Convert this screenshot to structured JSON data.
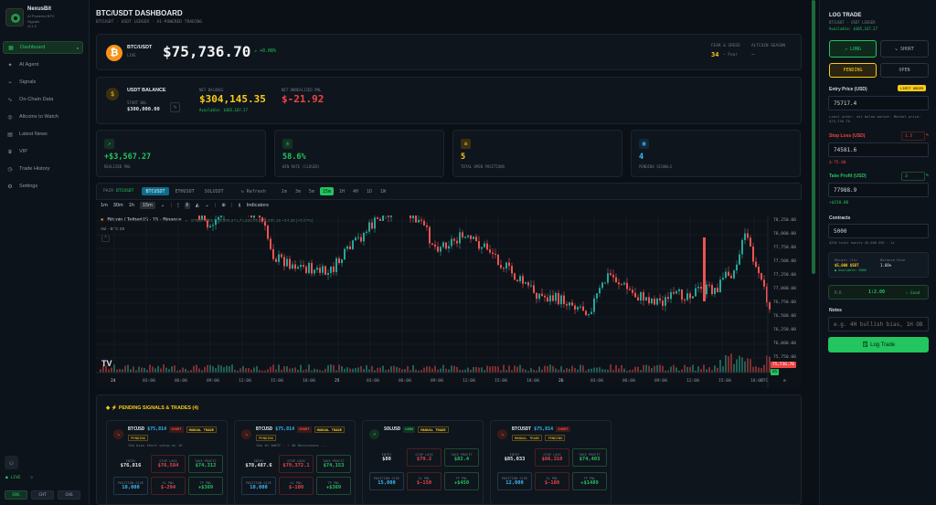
{
  "sidebar": {
    "brand": "NexusBit",
    "brand_sub1": "AI Powered BTC",
    "brand_sub2": "Signals",
    "brand_sub3": "v2.1.0",
    "items": [
      {
        "label": "Dashboard",
        "icon": "grid-icon"
      },
      {
        "label": "AI Agent",
        "icon": "sparkle-icon"
      },
      {
        "label": "Signals",
        "icon": "signal-icon"
      },
      {
        "label": "On-Chain Data",
        "icon": "activity-icon"
      },
      {
        "label": "Altcoins to Watch",
        "icon": "eye-icon"
      },
      {
        "label": "Latest News",
        "icon": "news-icon"
      },
      {
        "label": "VIP",
        "icon": "crown-icon"
      },
      {
        "label": "Trade History",
        "icon": "clock-icon"
      },
      {
        "label": "Settings",
        "icon": "gear-icon"
      }
    ],
    "live": "LIVE",
    "lang": [
      "ENG",
      "CHT",
      "CHS"
    ]
  },
  "header": {
    "title": "BTC/USDT DASHBOARD",
    "subtitle": "BTCUSDT · USDT LEDGER · AI-POWERED TRADING"
  },
  "price": {
    "pair": "BTC/USDT",
    "pair_sub": "LIVE",
    "value": "$75,736.70",
    "change": "↗ +0.08%",
    "fg_label": "FEAR & GREED",
    "fg_value": "34",
    "fg_text": "Fear",
    "alt_label": "ALTCOIN SEASON",
    "alt_value": "—"
  },
  "balance": {
    "label": "USDT BALANCE",
    "start_label": "START BAL",
    "start_value": "$300,000.00",
    "net_label": "NET BALANCE",
    "net_value": "$304,145.35",
    "net_sub": "Available: $305,167.27",
    "pnl_label": "NET UNREALIZED PNL",
    "pnl_value": "$-21.92"
  },
  "stats": [
    {
      "value": "+$3,567.27",
      "label": "REALIZED PNL",
      "color": "green",
      "icon": "trend-icon"
    },
    {
      "value": "58.6%",
      "label": "WIN RATE (CLOSED)",
      "color": "green",
      "icon": "target-icon"
    },
    {
      "value": "5",
      "label": "TOTAL OPEN POSITIONS",
      "color": "yellow",
      "icon": "layers-icon"
    },
    {
      "value": "4",
      "label": "PENDING SIGNALS",
      "color": "blue",
      "icon": "queue-icon"
    }
  ],
  "chart_tabs": {
    "label": "PAIR",
    "pair": "BTCUSDT",
    "tabs": [
      "BTCUSDT",
      "ETHUSDT",
      "SOLUSDT"
    ],
    "refresh": "↻ Refresh",
    "timeframes": [
      "1m",
      "3m",
      "5m",
      "15m",
      "1H",
      "4H",
      "1D",
      "1W"
    ],
    "active_tf": "15m"
  },
  "tv": {
    "intervals": [
      "1m",
      "30m",
      "1h",
      "15m"
    ],
    "indicators": "Indicators",
    "symbol": "Bitcoin / TetherUS · 15 · Binance",
    "ohlc": "O75,643.55 H75,808.24 L75,620.00 C75,638.19 +34.29 (+0.04%)",
    "vol": "Vol · BTC  29",
    "tv_logo": "TV",
    "y_labels": [
      "78,250.00",
      "78,000.00",
      "77,750.00",
      "77,500.00",
      "77,250.00",
      "77,000.00",
      "76,750.00",
      "76,500.00",
      "76,250.00",
      "76,000.00",
      "75,750.00"
    ],
    "x_labels": [
      "24",
      "03:00",
      "06:00",
      "09:00",
      "12:00",
      "15:00",
      "18:00",
      "25",
      "03:00",
      "06:00",
      "09:00",
      "12:00",
      "15:00",
      "18:00",
      "26",
      "03:00",
      "06:00",
      "09:00",
      "12:00",
      "15:00",
      "18:00"
    ],
    "tz": "UTC",
    "last_label": "75,736.70",
    "last_time": "05"
  },
  "pending": {
    "title": "◆ ⚡ PENDING SIGNALS & TRADES (4)",
    "cards": [
      {
        "symbol": "BTCUSD",
        "price": "$75,814",
        "side": "SHORT",
        "tag": "MANUAL TRADE",
        "status": "PENDING",
        "note": "15m bias Short setup on 1H",
        "e1_label": "ENTRY",
        "e1": "$76,816",
        "e2_label": "STOP LOSS",
        "e2": "$76,584",
        "e3_label": "TAKE PROFIT",
        "e3": "$74,312",
        "b1_label": "POSITION SIZE",
        "b1": "10,000",
        "b2_label": "SL PNL",
        "b2": "$-294",
        "b3_label": "TP PNL",
        "b3": "+$369",
        "dir": "short"
      },
      {
        "symbol": "BTCUSD",
        "price": "$75,814",
        "side": "SHORT",
        "tag": "MANUAL TRADE",
        "status": "PENDING",
        "note": "15m 1H 1WKTF · ⚡ 4H Resistance ...",
        "e1_label": "ENTRY",
        "e1": "$78,487.6",
        "e2_label": "STOP LOSS",
        "e2": "$79,372.1",
        "e3_label": "TAKE PROFIT",
        "e3": "$74,153",
        "b1_label": "POSITION SIZE",
        "b1": "10,000",
        "b2_label": "SL PNL",
        "b2": "$-100",
        "b3_label": "TP PNL",
        "b3": "+$369",
        "dir": "short"
      },
      {
        "symbol": "SOLUSD",
        "price": "",
        "side": "LONG",
        "tag": "MANUAL TRADE",
        "status": "",
        "note": "",
        "e1_label": "ENTRY",
        "e1": "$80",
        "e2_label": "STOP LOSS",
        "e2": "$79.2",
        "e3_label": "TAKE PROFIT",
        "e3": "$82.4",
        "b1_label": "POSITION SIZE",
        "b1": "15,000",
        "b2_label": "SL PNL",
        "b2": "$-150",
        "b3_label": "TP PNL",
        "b3": "+$450",
        "dir": "long"
      },
      {
        "symbol": "BTCUSDT",
        "price": "$75,814",
        "side": "SHORT",
        "tag": "MANUAL TRADE",
        "status": "PENDING",
        "note": "",
        "e1_label": "ENTRY",
        "e1": "$85,033",
        "e2_label": "STOP LOSS",
        "e2": "$86,310",
        "e3_label": "TAKE PROFIT",
        "e3": "$74,403",
        "b1_label": "POSITION SIZE",
        "b1": "12,000",
        "b2_label": "SL PNL",
        "b2": "$-180",
        "b3_label": "TP PNL",
        "b3": "+$1489",
        "dir": "short"
      }
    ]
  },
  "log": {
    "title": "LOG TRADE",
    "sub1": "BTCUSDT · USDT LEDGER",
    "sub2": "Available: $305,167.27",
    "long": "↗ LONG",
    "short": "↘ SHORT",
    "pending": "PENDING",
    "open": "OPEN",
    "entry_label": "Entry Price (USD)",
    "entry_tag": "LIMIT ORDER",
    "entry_value": "75717.4",
    "entry_hint": "Limit order: set below market. Market price: $75,736.70",
    "sl_label": "Stop Loss (USD)",
    "sl_pct": "1.5",
    "sl_value": "74581.6",
    "sl_pnl": "$-75.00",
    "tp_label": "Take Profit (USD)",
    "tp_pct": "3",
    "tp_value": "77988.9",
    "tp_pnl": "+$150.00",
    "contracts_label": "Contracts",
    "contracts_value": "5000",
    "contracts_hint": "$250 total equity $5,000 USD · 1x",
    "margin_label": "Margin (1x)",
    "margin_value": "$5,000 USDT",
    "margin_sub": "● Available: 8000",
    "bal_after_label": "Balance Risk",
    "bal_after_value": "1.66%",
    "rr_label": "R:R",
    "rr_value": "1:2.00",
    "rr_status": "✓ Good",
    "notes_label": "Notes",
    "notes_placeholder": "e.g. 4H bullish bias, 1H OB",
    "submit": "🗒 Log Trade"
  }
}
